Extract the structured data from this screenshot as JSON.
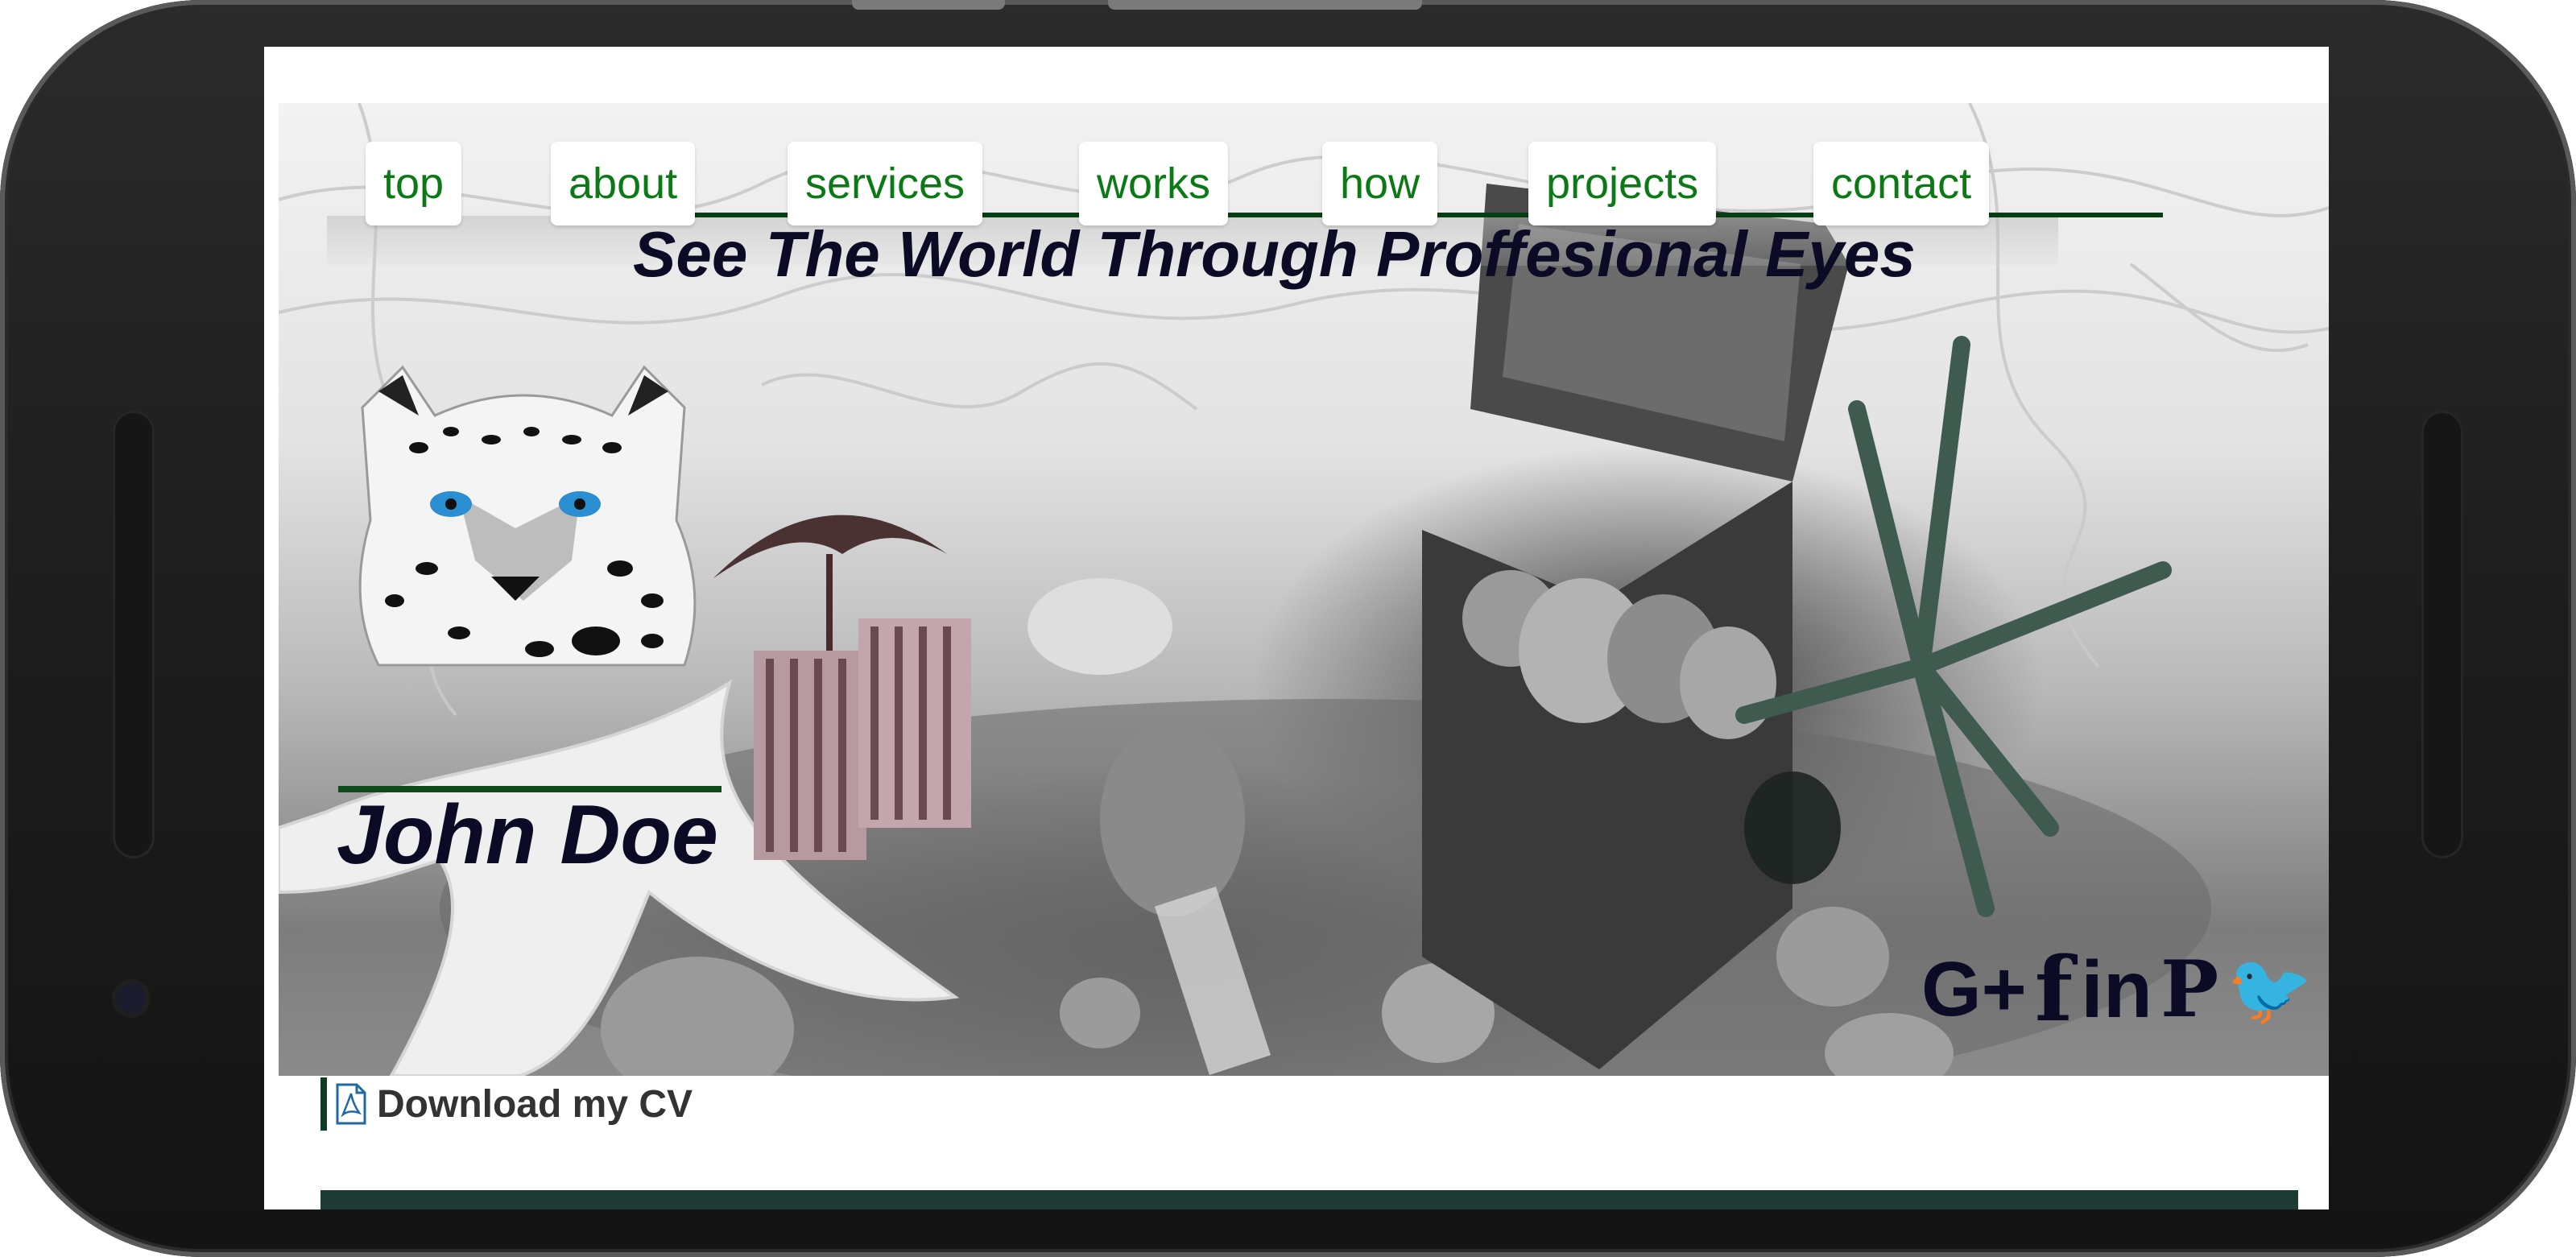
{
  "nav": {
    "items": [
      {
        "label": "top"
      },
      {
        "label": "about"
      },
      {
        "label": "services"
      },
      {
        "label": "works"
      },
      {
        "label": "how"
      },
      {
        "label": "projects"
      },
      {
        "label": "contact"
      }
    ]
  },
  "hero": {
    "tagline": "See The World Through Proffesional Eyes",
    "name": "John Doe"
  },
  "social": {
    "items": [
      {
        "icon": "google-plus-icon",
        "glyph": "G+"
      },
      {
        "icon": "facebook-icon",
        "glyph": "f"
      },
      {
        "icon": "linkedin-icon",
        "glyph": "in"
      },
      {
        "icon": "pinterest-icon",
        "glyph": "P"
      },
      {
        "icon": "twitter-icon",
        "glyph": "🐦"
      }
    ]
  },
  "download": {
    "label": "Download my CV",
    "icon": "pdf-icon"
  },
  "colors": {
    "nav_text": "#0b7a15",
    "accent_dark_green": "#063d12",
    "heading": "#0b0b26",
    "band": "#1d3b33"
  }
}
